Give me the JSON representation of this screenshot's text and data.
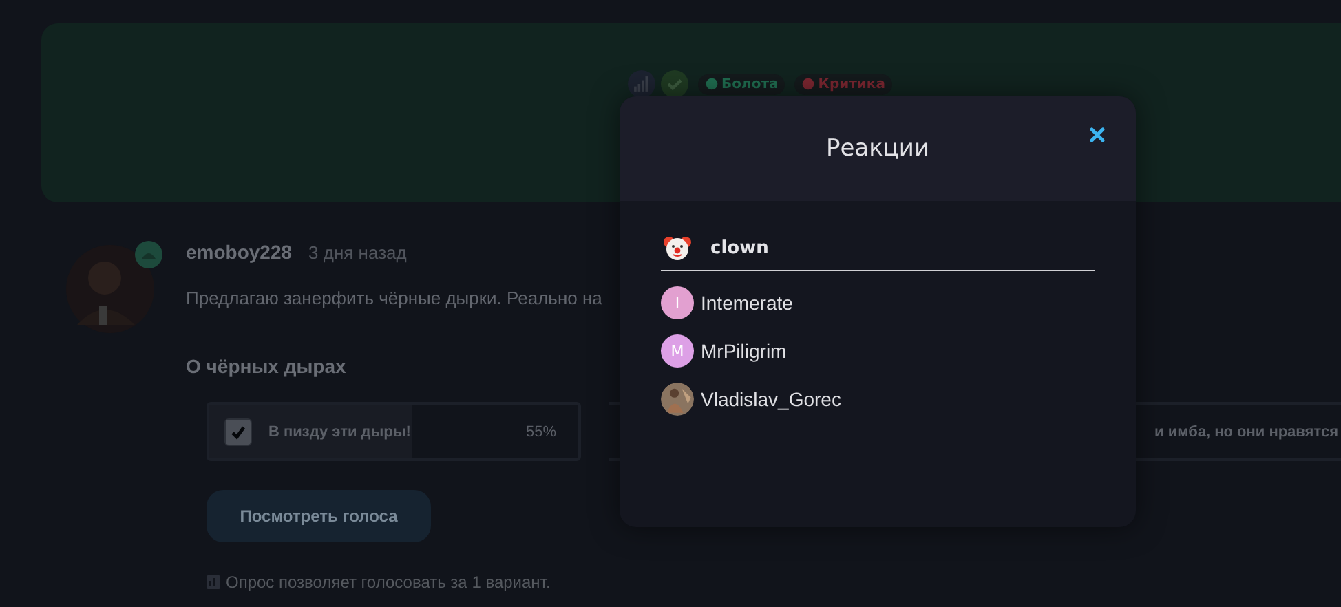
{
  "banner": {
    "tags": [
      {
        "label": "Болота",
        "color": "#1f6b4f"
      },
      {
        "label": "Критика",
        "color": "#7a2630"
      }
    ]
  },
  "post": {
    "author": "emoboy228",
    "time": "3 дня назад",
    "text": "Предлагаю занерфить чёрные дырки. Реально на",
    "poll": {
      "title": "О чёрных дырах",
      "options": [
        {
          "label": "В пизду эти дыры!",
          "checked": true,
          "level": 0.55,
          "percent": "55%"
        },
        {
          "label": "и имба, но они нравятся"
        }
      ],
      "button": "Посмотреть голоса",
      "note": "Опрос позволяет голосовать за 1 вариант."
    }
  },
  "modal": {
    "title": "Реакции",
    "reaction": "clown",
    "users": [
      {
        "name": "Intemerate",
        "initial": "I",
        "color": "#e2a0d0"
      },
      {
        "name": "MrPiligrim",
        "initial": "M",
        "color": "#dda0e6"
      },
      {
        "name": "Vladislav_Gorec",
        "kind": "picture"
      }
    ]
  }
}
